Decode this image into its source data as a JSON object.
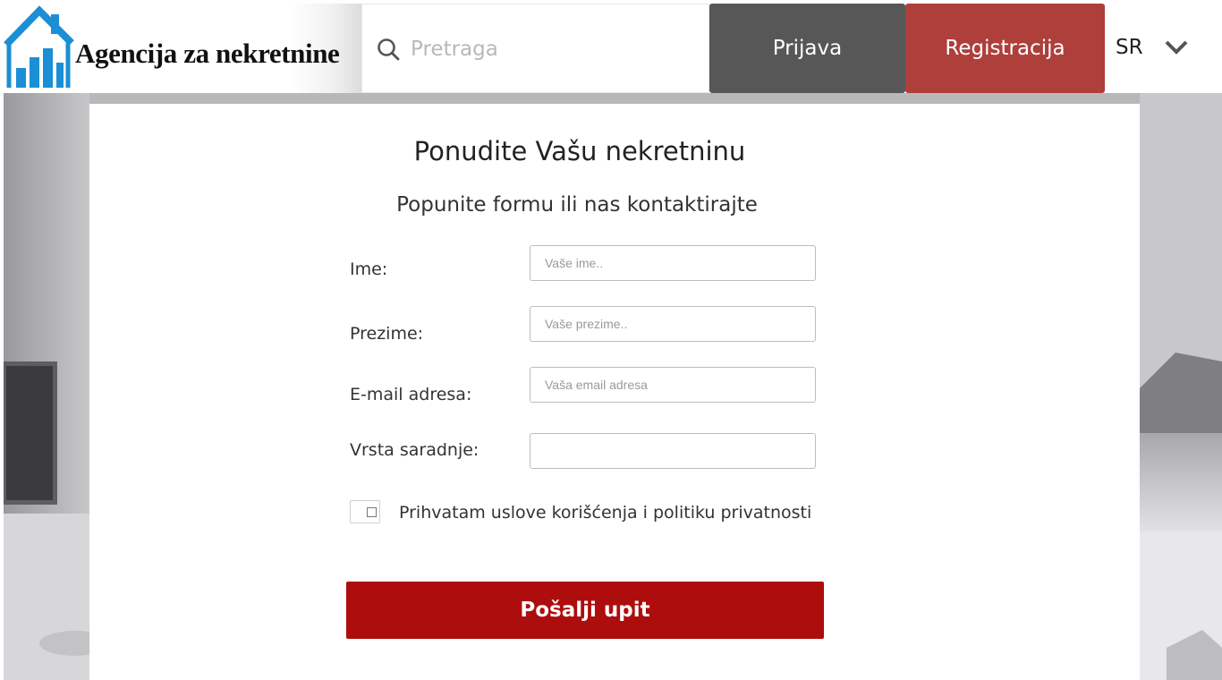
{
  "header": {
    "logo_text": "Agencija za nekretnine",
    "search_placeholder": "Pretraga",
    "login_label": "Prijava",
    "register_label": "Registracija",
    "language": "SR"
  },
  "form": {
    "title": "Ponudite Vašu nekretninu",
    "subtitle": "Popunite formu ili nas kontaktirajte",
    "fields": [
      {
        "label": "Ime:",
        "placeholder": "Vaše ime..",
        "value": ""
      },
      {
        "label": "Prezime:",
        "placeholder": "Vaše prezime..",
        "value": ""
      },
      {
        "label": "E-mail adresa:",
        "placeholder": "Vaša email adresa",
        "value": ""
      },
      {
        "label": "Vrsta saradnje:",
        "placeholder": "",
        "value": ""
      }
    ],
    "terms_label": "Prihvatam uslove korišćenja i politiku privatnosti",
    "submit_label": "Pošalji upit"
  },
  "colors": {
    "brand_blue": "#1a8fd6",
    "login_bg": "#575757",
    "register_bg": "#ae3f3b",
    "submit_bg": "#ad0d0c"
  },
  "icons": {
    "logo": "house-chart-logo-icon",
    "search": "search-icon",
    "language_dropdown": "chevron-down-icon"
  }
}
